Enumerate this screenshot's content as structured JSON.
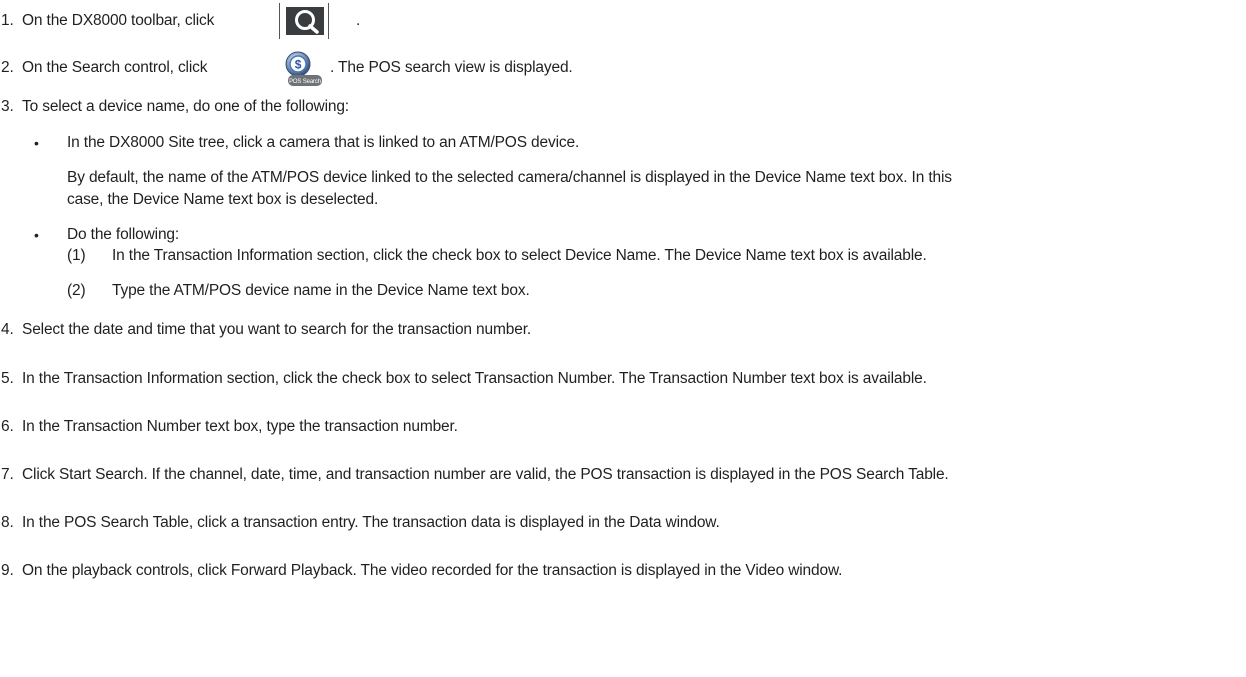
{
  "steps": [
    {
      "num": "1.",
      "text_before": "On the DX8000 toolbar, click",
      "text_after": "."
    },
    {
      "num": "2.",
      "text_before": "On the Search control, click",
      "text_after": ". The POS search view is displayed.",
      "icon_label": "POS Search",
      "icon_symbol": "$"
    },
    {
      "num": "3.",
      "text": "To select a device name, do one of the following:"
    },
    {
      "num": "4.",
      "text": "Select the date and time that you want to search for the transaction number."
    },
    {
      "num": "5.",
      "text": "In the Transaction Information section, click the check box to select Transaction Number. The Transaction Number text box is available."
    },
    {
      "num": "6.",
      "text": "In the Transaction Number text box, type the transaction number."
    },
    {
      "num": "7.",
      "text": "Click Start Search. If the channel, date, time, and transaction number are valid, the POS transaction is displayed in the POS Search Table."
    },
    {
      "num": "8.",
      "text": "In the POS Search Table, click a transaction entry. The transaction data is displayed in the Data window."
    },
    {
      "num": "9.",
      "text": "On the playback controls, click Forward Playback. The video recorded for the transaction is displayed in the Video window."
    }
  ],
  "bullets": [
    {
      "symbol": "•",
      "text": "In the DX8000 Site tree, click a camera that is linked to an ATM/POS device.",
      "note_line1": "By default, the name of the ATM/POS device linked to the selected camera/channel is displayed in the Device Name text box. In this",
      "note_line2": "case, the Device Name text box is deselected."
    },
    {
      "symbol": "•",
      "text": "Do the following:",
      "substeps": [
        {
          "num": "(1)",
          "text": "In the Transaction Information section, click the check box to select Device Name. The Device Name text box is available."
        },
        {
          "num": "(2)",
          "text": "Type the ATM/POS device name in the Device Name text box."
        }
      ]
    }
  ],
  "icons": {
    "toolbar_search": "search-icon",
    "pos_search": "pos-search-icon"
  },
  "colors": {
    "text": "#231f20",
    "icon_dark": "#3a3d40",
    "icon_blue": "#4a78b8"
  }
}
